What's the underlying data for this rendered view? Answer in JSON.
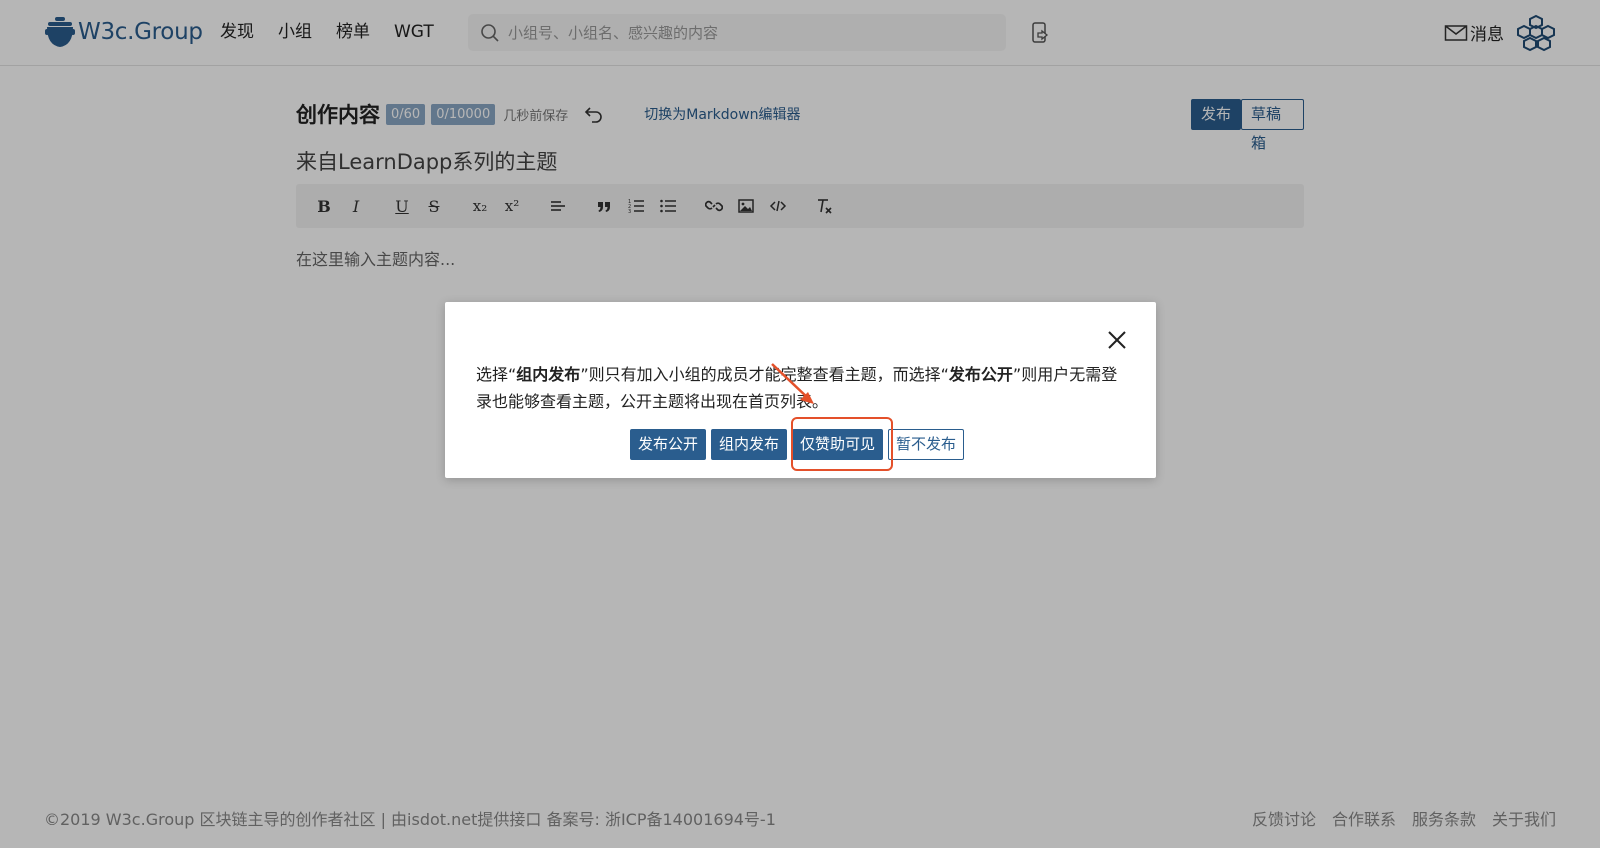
{
  "header": {
    "logo_text": "W3c.Group",
    "nav": [
      "发现",
      "小组",
      "榜单",
      "WGT"
    ],
    "search_placeholder": "小组号、小组名、感兴趣的内容",
    "messages_label": "消息"
  },
  "editor": {
    "heading": "创作内容",
    "title_counter": "0/60",
    "content_counter": "0/10000",
    "saved_status": "几秒前保存",
    "switch_editor": "切换为Markdown编辑器",
    "publish_label": "发布",
    "drafts_label": "草稿箱",
    "topic_title": "来自LearnDapp系列的主题",
    "content_placeholder": "在这里输入主题内容...",
    "toolbar": {
      "bold": "B",
      "italic": "I",
      "underline": "U",
      "strike": "S",
      "subscript": "x₂",
      "superscript": "x²"
    }
  },
  "footer": {
    "left": "©2019 W3c.Group 区块链主导的创作者社区   |   由isdot.net提供接口 备案号: 浙ICP备14001694号-1",
    "links": [
      "反馈讨论",
      "合作联系",
      "服务条款",
      "关于我们"
    ]
  },
  "modal": {
    "text_1": "选择“",
    "text_bold_1": "组内发布",
    "text_2": "”则只有加入小组的成员才能完整查看主题，而选择“",
    "text_bold_2": "发布公开",
    "text_3": "”则用户无需登录也能够查看主题，公开主题将出现在首页列表。",
    "buttons": {
      "public": "发布公开",
      "group": "组内发布",
      "sponsor": "仅赞助可见",
      "later": "暂不发布"
    }
  },
  "colors": {
    "brand": "#2a5d8e",
    "highlight": "#e4502a"
  }
}
